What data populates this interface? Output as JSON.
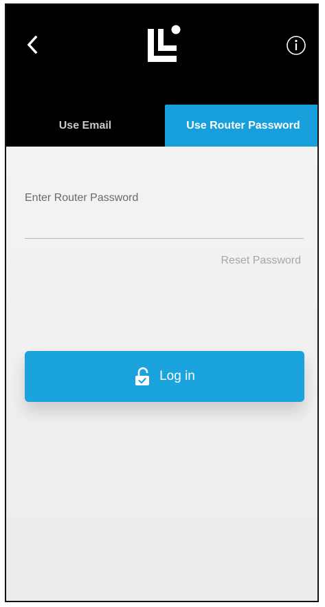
{
  "header": {
    "back_icon": "chevron-left-icon",
    "logo_icon": "linksys-logo-icon",
    "info_icon": "info-icon"
  },
  "tabs": [
    {
      "label": "Use Email",
      "active": false
    },
    {
      "label": "Use Router Password",
      "active": true
    }
  ],
  "form": {
    "field_label": "Enter Router Password",
    "password_value": "",
    "reset_link": "Reset Password",
    "login_label": "Log in",
    "login_icon": "unlocked-padlock-icon"
  },
  "colors": {
    "header_bg": "#000000",
    "accent": "#169fdb",
    "form_bg": "#eeeeee",
    "label_gray": "#6a6a6a",
    "link_gray": "#a6a6a6"
  }
}
